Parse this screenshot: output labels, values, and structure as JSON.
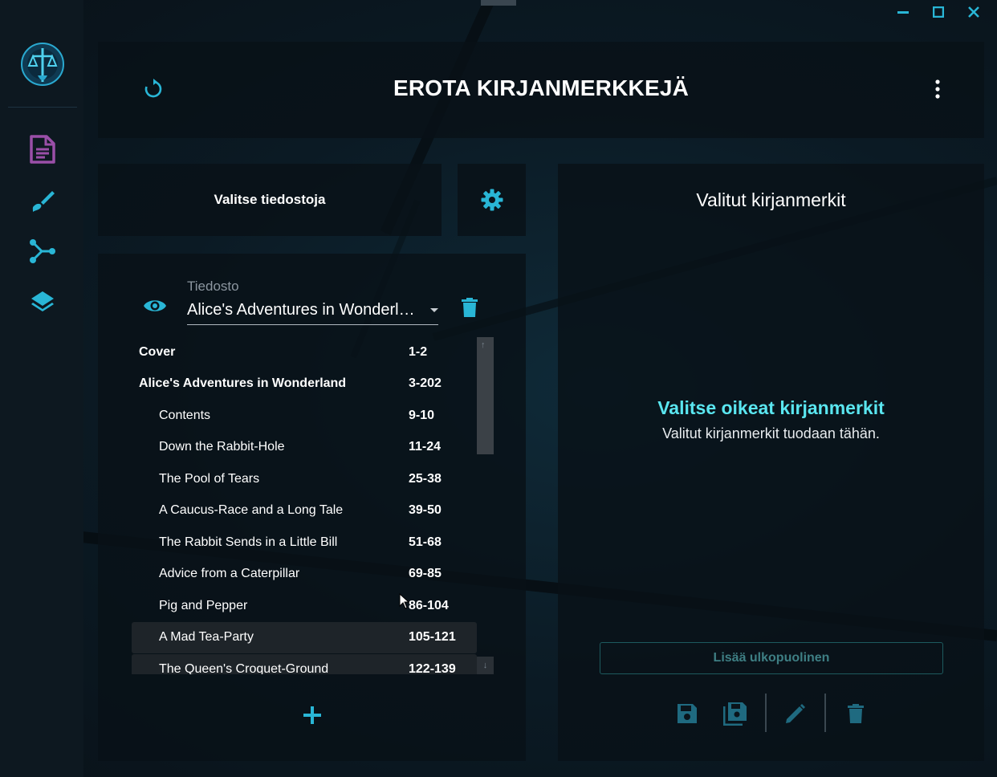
{
  "header": {
    "title": "EROTA KIRJANMERKKEJÄ"
  },
  "toolbar": {
    "select_files_label": "Valitse tiedostoja"
  },
  "file": {
    "label": "Tiedosto",
    "selected": "Alice's Adventures in Wonderland"
  },
  "bookmarks": [
    {
      "name": "Cover",
      "pages": "1-2",
      "level": "top"
    },
    {
      "name": "Alice's Adventures in Wonderland",
      "pages": "3-202",
      "level": "top"
    },
    {
      "name": "Contents",
      "pages": "9-10",
      "level": "sub"
    },
    {
      "name": "Down the Rabbit-Hole",
      "pages": "11-24",
      "level": "sub"
    },
    {
      "name": "The Pool of Tears",
      "pages": "25-38",
      "level": "sub"
    },
    {
      "name": "A Caucus-Race and a Long Tale",
      "pages": "39-50",
      "level": "sub"
    },
    {
      "name": "The Rabbit Sends in a Little Bill",
      "pages": "51-68",
      "level": "sub"
    },
    {
      "name": "Advice from a Caterpillar",
      "pages": "69-85",
      "level": "sub"
    },
    {
      "name": "Pig and Pepper",
      "pages": "86-104",
      "level": "sub"
    },
    {
      "name": "A Mad Tea-Party",
      "pages": "105-121",
      "level": "sub"
    },
    {
      "name": "The Queen's Croquet-Ground",
      "pages": "122-139",
      "level": "sub"
    }
  ],
  "right_panel": {
    "title": "Valitut kirjanmerkit",
    "empty_title": "Valitse oikeat kirjanmerkit",
    "empty_subtitle": "Valitut kirjanmerkit tuodaan tähän.",
    "add_external_label": "Lisää ulkopuolinen"
  },
  "colors": {
    "accent": "#29b6d6",
    "accent_light": "#5ae6f0",
    "document_icon": "#9a4fa8",
    "disabled_icon": "#1f6a80"
  },
  "icons": {
    "sidebar": [
      "document-icon",
      "brush-icon",
      "merge-icon",
      "layers-icon"
    ],
    "window": [
      "minimize-icon",
      "maximize-icon",
      "close-icon"
    ]
  }
}
